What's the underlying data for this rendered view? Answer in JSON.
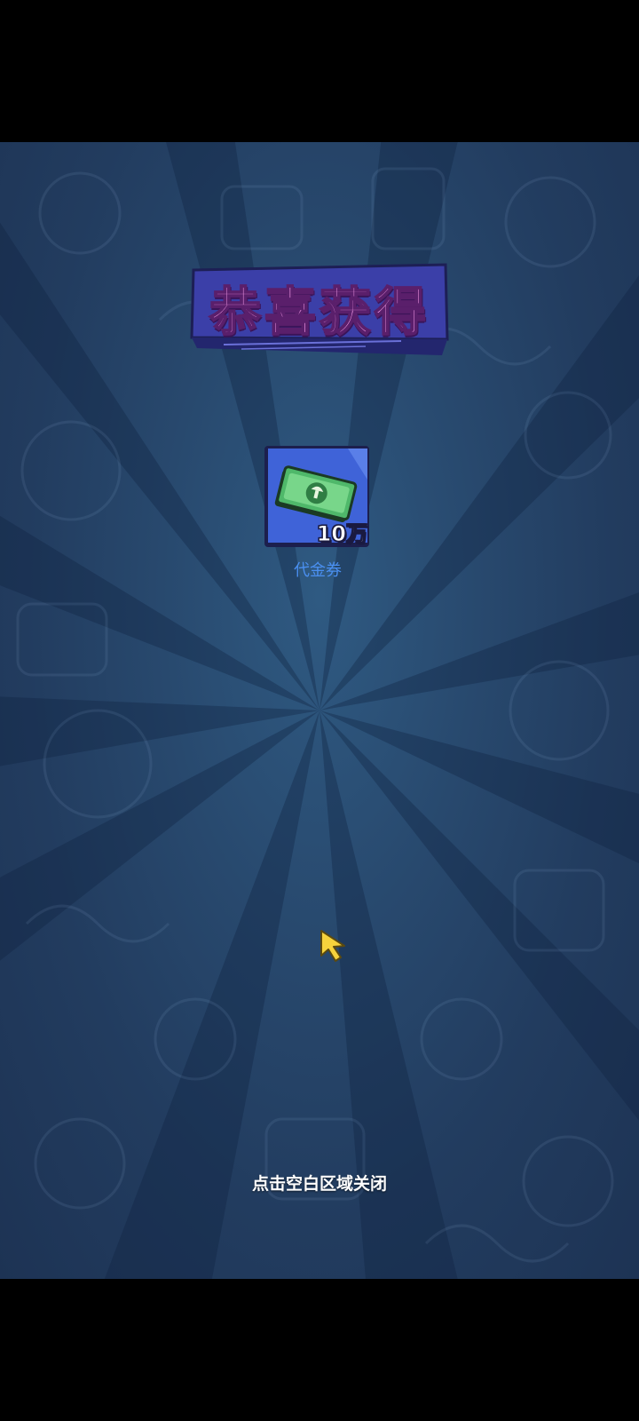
{
  "popup": {
    "title": "恭喜获得",
    "reward": {
      "amount": "10万",
      "name": "代金券",
      "icon": "banknote-icon"
    },
    "close_hint": "点击空白区域关闭"
  },
  "colors": {
    "background": "#263f63",
    "title_fill": "#f59be8",
    "banner_fill": "#3b3fa8",
    "card_fill": "#3f63d8",
    "reward_name": "#4a8ff0"
  },
  "cursor_icon": "pointer-cursor-icon"
}
